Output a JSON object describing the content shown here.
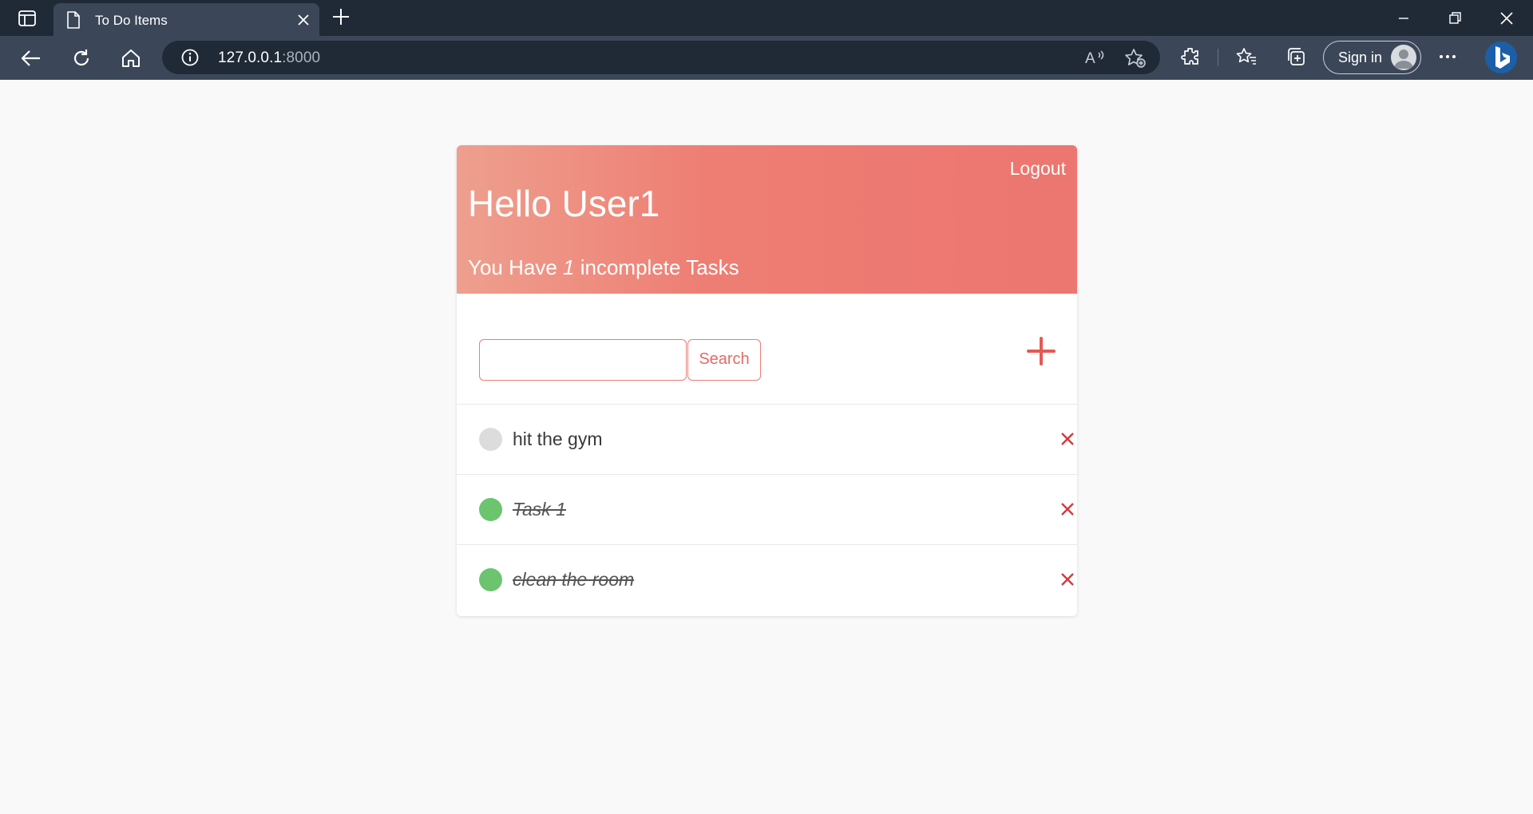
{
  "browser": {
    "tab_title": "To Do Items",
    "url_host": "127.0.0.1",
    "url_port": ":8000",
    "sign_in_label": "Sign in"
  },
  "header": {
    "logout_label": "Logout",
    "greeting": "Hello User1",
    "subtitle_prefix": "You Have ",
    "incomplete_count": "1",
    "subtitle_suffix": " incomplete Tasks"
  },
  "search": {
    "value": "",
    "placeholder": "",
    "button_label": "Search"
  },
  "tasks": [
    {
      "title": "hit the gym",
      "complete": false
    },
    {
      "title": "Task 1",
      "complete": true
    },
    {
      "title": "clean the room",
      "complete": true
    }
  ],
  "colors": {
    "accent": "#ec7670",
    "header_gradient_start": "#ee9f8e",
    "complete_dot": "#6cc46e",
    "incomplete_dot": "#dcdcdc",
    "delete": "#d9373c"
  },
  "icons": {
    "sidebar": "sidebar-toggle-icon",
    "tab": "document-icon",
    "add_task": "plus-icon",
    "delete_task": "close-x-icon"
  }
}
